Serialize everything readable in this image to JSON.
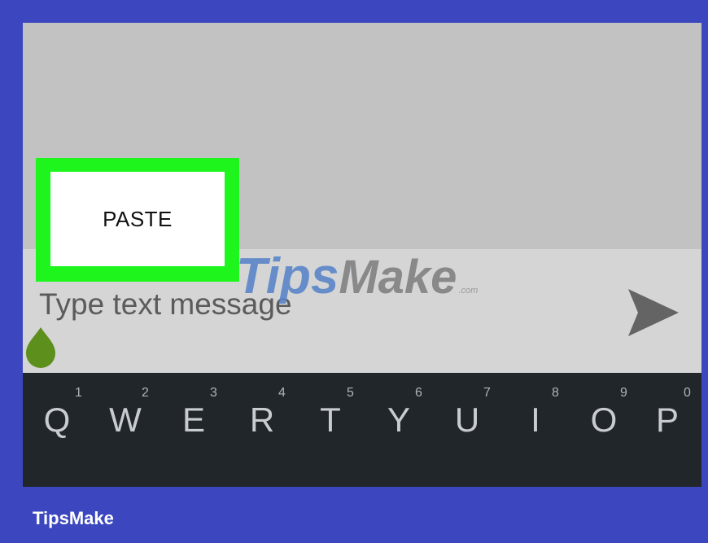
{
  "paste_button": {
    "label": "PASTE"
  },
  "compose": {
    "placeholder": "Type text message"
  },
  "send": {
    "icon": "send-icon"
  },
  "watermark": {
    "part1": "Tips",
    "part2": "Make",
    "suffix": ".com"
  },
  "keyboard": {
    "keys": [
      {
        "letter": "Q",
        "number": "1"
      },
      {
        "letter": "W",
        "number": "2"
      },
      {
        "letter": "E",
        "number": "3"
      },
      {
        "letter": "R",
        "number": "4"
      },
      {
        "letter": "T",
        "number": "5"
      },
      {
        "letter": "Y",
        "number": "6"
      },
      {
        "letter": "U",
        "number": "7"
      },
      {
        "letter": "I",
        "number": "8"
      },
      {
        "letter": "O",
        "number": "9"
      },
      {
        "letter": "P",
        "number": "0"
      }
    ]
  },
  "footer": {
    "brand": "TipsMake"
  },
  "colors": {
    "border": "#3c47bf",
    "highlight": "#1df51d",
    "keyboard_bg": "#21262b",
    "cursor_handle": "#5c8f1c"
  }
}
